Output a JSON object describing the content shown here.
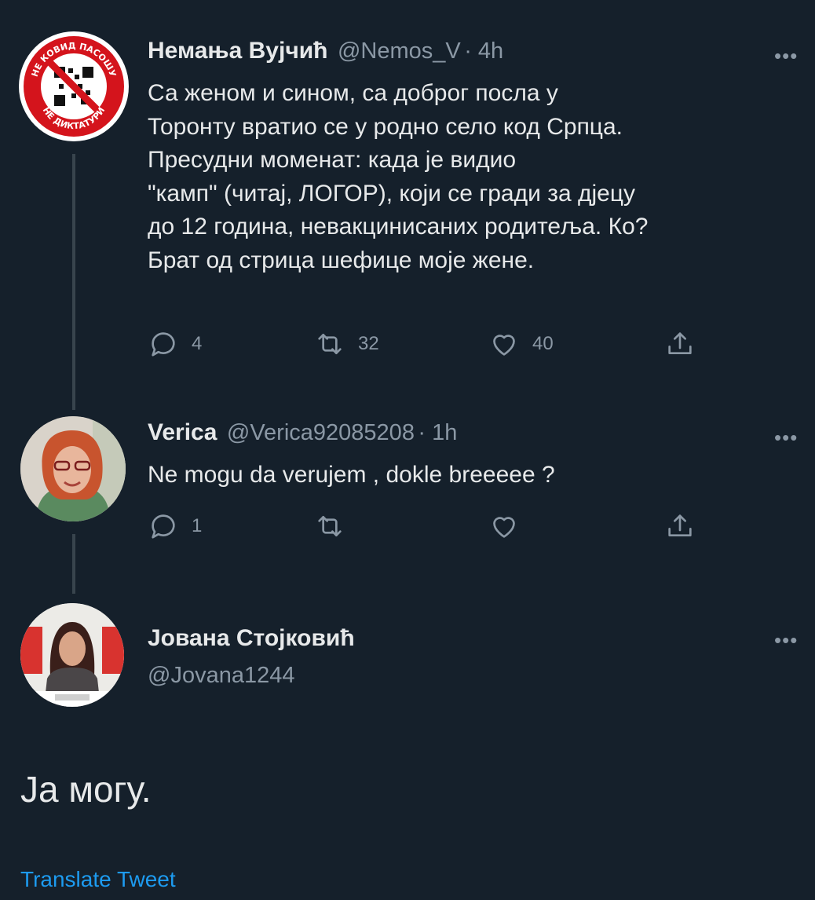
{
  "tweets": [
    {
      "name": "Немања Вујчић",
      "handle": "@Nemos_V",
      "time": "· 4h",
      "lines": [
        "Са женом и сином, са доброг посла у",
        "Торонту вратио се у родно село код Српца.",
        "Пресудни моменат: када је видио",
        "\"камп\" (читај, ЛОГОР), који се гради за дјецу",
        "до 12 година, невакцинисаних родитеља. Ко?",
        "Брат од стрица шефице моје жене."
      ],
      "replies": "4",
      "retweets": "32",
      "likes": "40",
      "avatar_text_top": "НЕ КОВИД ПАСОШУ",
      "avatar_text_bottom": "НЕ ДИКТАТУРИ"
    },
    {
      "name": "Verica",
      "handle": "@Verica92085208",
      "time": "· 1h",
      "text": "Ne mogu da verujem , dokle breeeee ?",
      "replies": "1"
    },
    {
      "name": "Јована Стојковић",
      "handle": "@Jovana1244",
      "text": "Ја могу."
    }
  ],
  "more_symbol": "•••",
  "translate": "Translate Tweet",
  "colors": {
    "background": "#15202b",
    "text": "#e7e9ea",
    "muted": "#8b98a5",
    "link": "#1d9bf0",
    "thread_line": "#38444d"
  }
}
